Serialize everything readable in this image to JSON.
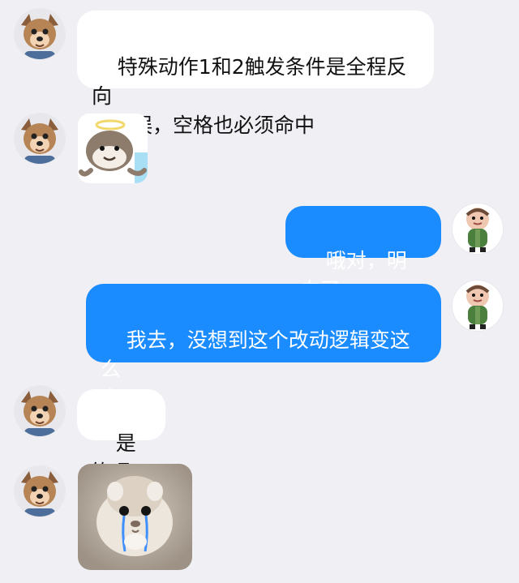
{
  "messages": [
    {
      "sender": "left",
      "type": "text",
      "text": "特殊动作1和2触发条件是全程反向\n不失误，空格也必须命中"
    },
    {
      "sender": "left",
      "type": "sticker",
      "sticker": "otter-halo-sticker"
    },
    {
      "sender": "right",
      "type": "text",
      "text": "哦对，明白了"
    },
    {
      "sender": "right",
      "type": "text",
      "text": "我去，没想到这个改动逻辑变这么\n多"
    },
    {
      "sender": "left",
      "type": "text",
      "text": "是的呢"
    },
    {
      "sender": "left",
      "type": "sticker",
      "sticker": "crying-hamster-sticker"
    }
  ],
  "colors": {
    "background": "#efeff4",
    "left_bubble": "#ffffff",
    "right_bubble": "#1a8cff",
    "right_text": "#ffffff"
  }
}
